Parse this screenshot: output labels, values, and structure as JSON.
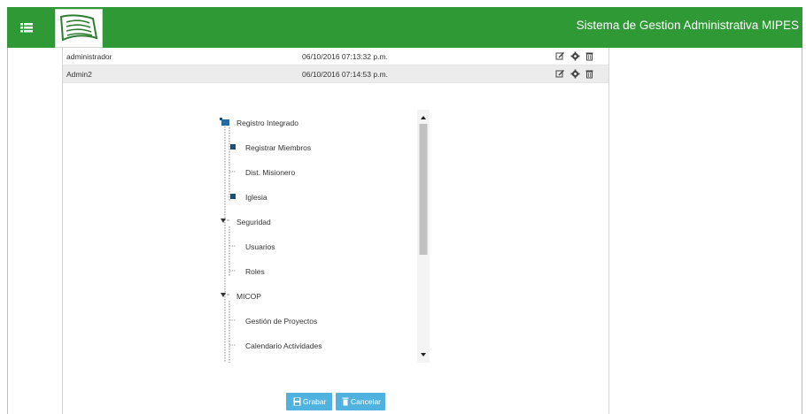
{
  "header": {
    "title": "Sistema de Gestion Administrativa MIPES",
    "menu_icon": "list-icon",
    "logo_icon": "bible-logo-icon",
    "bg_color": "#2f9a35"
  },
  "users": [
    {
      "name": "administrador",
      "date": "06/10/2016 07:13:32 p.m."
    },
    {
      "name": "Admin2",
      "date": "06/10/2016 07:14:53 p.m."
    }
  ],
  "row_actions": [
    "edit-icon",
    "gear-icon",
    "trash-icon"
  ],
  "tree": [
    {
      "label": "Registro Integrado",
      "level": 0,
      "icon": "folder-icon"
    },
    {
      "label": "Registrar Miembros",
      "level": 1,
      "icon": "node-icon"
    },
    {
      "label": "Dist. Misionero",
      "level": 1,
      "icon": "leaf-icon"
    },
    {
      "label": "Iglesia",
      "level": 1,
      "icon": "node-icon"
    },
    {
      "label": "Seguridad",
      "level": 0,
      "icon": "expand-icon"
    },
    {
      "label": "Usuarios",
      "level": 1,
      "icon": "leaf-icon"
    },
    {
      "label": "Roles",
      "level": 1,
      "icon": "leaf-icon"
    },
    {
      "label": "MICOP",
      "level": 0,
      "icon": "expand-icon"
    },
    {
      "label": "Gestión de Proyectos",
      "level": 1,
      "icon": "leaf-icon"
    },
    {
      "label": "Calendario Actividades",
      "level": 1,
      "icon": "leaf-icon"
    }
  ],
  "buttons": {
    "save_label": "Grabar",
    "cancel_label": "Cancelar",
    "save_icon": "save-icon",
    "cancel_icon": "cancel-icon",
    "color": "#4fb2df"
  }
}
